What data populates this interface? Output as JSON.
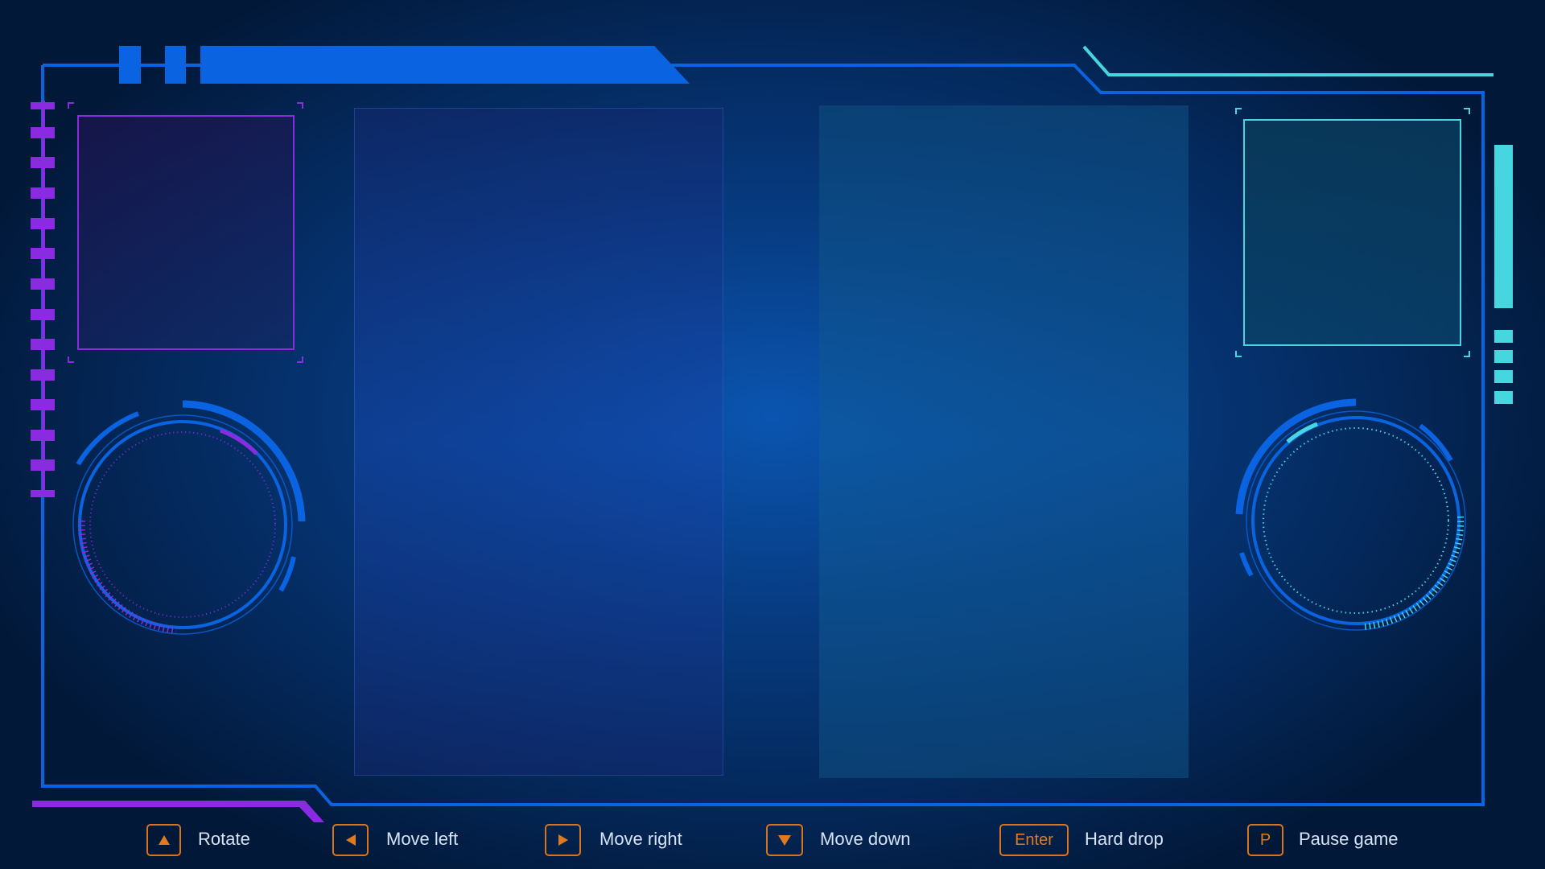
{
  "colors": {
    "frame_blue": "#0a63e0",
    "accent_purple": "#8a2be2",
    "accent_cyan": "#45d6e0",
    "key_orange": "#e07a20",
    "label_text": "#d8e4f5"
  },
  "controls": [
    {
      "key_icon": "up-arrow-icon",
      "key_text": "",
      "label": "Rotate"
    },
    {
      "key_icon": "left-arrow-icon",
      "key_text": "",
      "label": "Move left"
    },
    {
      "key_icon": "right-arrow-icon",
      "key_text": "",
      "label": "Move right"
    },
    {
      "key_icon": "down-arrow-icon",
      "key_text": "",
      "label": "Move down"
    },
    {
      "key_icon": "",
      "key_text": "Enter",
      "label": "Hard drop"
    },
    {
      "key_icon": "",
      "key_text": "P",
      "label": "Pause game"
    }
  ]
}
